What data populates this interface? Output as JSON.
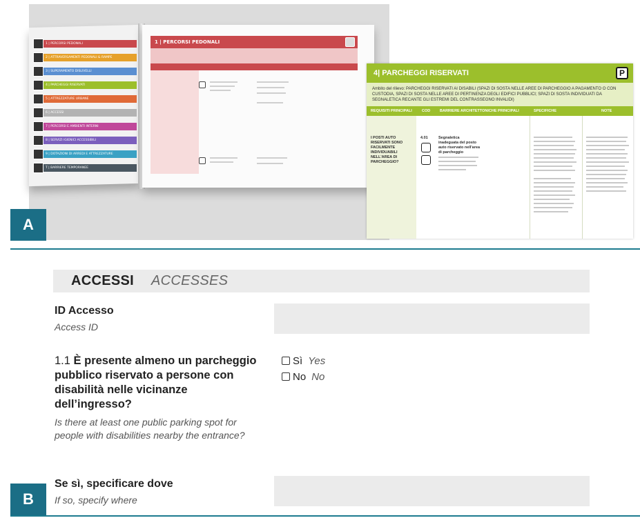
{
  "panel_a": {
    "label": "A",
    "book_left_page": {
      "menu": [
        {
          "label": "1 | PERCORSI PEDONALI",
          "color": "#c9494d"
        },
        {
          "label": "2 | ATTRAVERSAMENTI PEDONALI & RAMPE",
          "color": "#e6a12a"
        },
        {
          "label": "3 | SUPERAMENTO DISLIVELLI",
          "color": "#5a8fd1"
        },
        {
          "label": "4 | PARCHEGGI RISERVATI",
          "color": "#9cbf2c"
        },
        {
          "label": "5 | ATTREZZATURE URBANE",
          "color": "#e06a37"
        },
        {
          "label": "6 | ACCESSI",
          "color": "#b3b3b3"
        },
        {
          "label": "7 | PERCORSI E AMBIENTI INTERNI",
          "color": "#c0489a"
        },
        {
          "label": "8 | SERVIZI IGIENICI ACCESSIBILI",
          "color": "#7b5fbd"
        },
        {
          "label": "9 | DOTAZIONI DI ARREDI E ATTREZZATURE",
          "color": "#3aa1c4"
        },
        {
          "label": "T | BARRIERE TEMPORANEE",
          "color": "#4a5761"
        }
      ]
    },
    "book_right_page": {
      "title": "1 | PERCORSI PEDONALI",
      "accent": "#c9494d"
    },
    "overlay_card": {
      "title": "4| PARCHEGGI RISERVATI",
      "icon_letter": "P",
      "accent": "#9cbf2c",
      "scope_text": "Ambito del rilievo: PARCHEGGI RISERVATI AI DISABILI (SPAZI DI SOSTA NELLE AREE DI PARCHEGGIO A PAGAMENTO O CON CUSTODIA, SPAZI DI SOSTA NELLE AREE DI PERTINENZA DEGLI EDIFICI PUBBLICI; SPAZI DI SOSTA INDIVIDUATI DA SEGNALETICA RECANTE GLI ESTREMI DEL CONTRASSEGNO INVALIDI)",
      "columns": [
        "REQUISITI PRINCIPALI",
        "COD",
        "BARRIERE ARCHITETTONICHE PRINCIPALI",
        "SPECIFICHE",
        "NOTE"
      ],
      "row": {
        "requirement": "I POSTI AUTO RISERVATI SONO FACILMENTE INDIVIDUABILI NELL'AREA DI PARCHEGGIO?",
        "code": "4.01",
        "barrier": "Segnaletica inadeguata del posto auto riservato nell'area di parcheggio"
      }
    }
  },
  "panel_b": {
    "label": "B",
    "section_title": "ACCESSI",
    "section_title_en": "ACCESSES",
    "access_id": {
      "label": "ID Accesso",
      "label_en": "Access ID",
      "value": ""
    },
    "question_1_1": {
      "number": "1.1",
      "label": "È presente almeno un parcheggio pubblico riservato a persone con disabilità nelle vicinanze dell’ingresso?",
      "label_en": "Is there at least one public parking spot for people with disabilities nearby the entrance?",
      "options": [
        {
          "label": "Sì",
          "label_en": "Yes",
          "checked": false
        },
        {
          "label": "No",
          "label_en": "No",
          "checked": false
        }
      ]
    },
    "specify_where": {
      "label": "Se sì, specificare dove",
      "label_en": "If so, specify where",
      "value": ""
    },
    "accent": "#1b6e86"
  }
}
